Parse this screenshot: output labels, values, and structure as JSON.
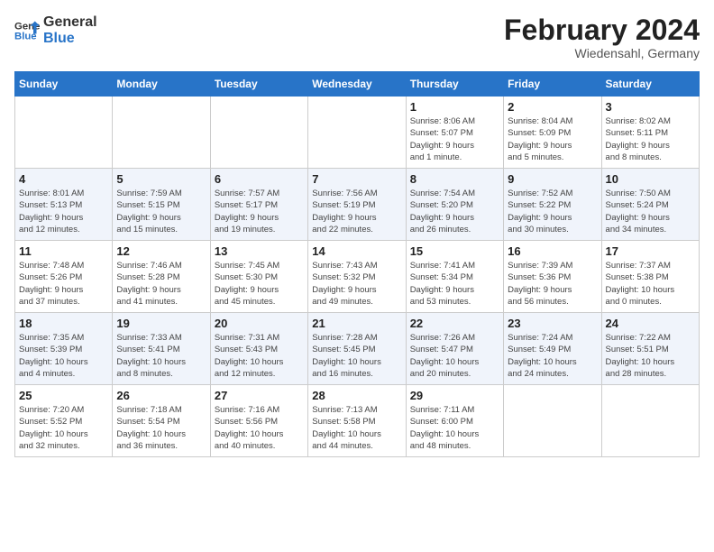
{
  "header": {
    "logo_general": "General",
    "logo_blue": "Blue",
    "title": "February 2024",
    "location": "Wiedensahl, Germany"
  },
  "calendar": {
    "days_of_week": [
      "Sunday",
      "Monday",
      "Tuesday",
      "Wednesday",
      "Thursday",
      "Friday",
      "Saturday"
    ],
    "weeks": [
      [
        {
          "day": "",
          "info": ""
        },
        {
          "day": "",
          "info": ""
        },
        {
          "day": "",
          "info": ""
        },
        {
          "day": "",
          "info": ""
        },
        {
          "day": "1",
          "info": "Sunrise: 8:06 AM\nSunset: 5:07 PM\nDaylight: 9 hours\nand 1 minute."
        },
        {
          "day": "2",
          "info": "Sunrise: 8:04 AM\nSunset: 5:09 PM\nDaylight: 9 hours\nand 5 minutes."
        },
        {
          "day": "3",
          "info": "Sunrise: 8:02 AM\nSunset: 5:11 PM\nDaylight: 9 hours\nand 8 minutes."
        }
      ],
      [
        {
          "day": "4",
          "info": "Sunrise: 8:01 AM\nSunset: 5:13 PM\nDaylight: 9 hours\nand 12 minutes."
        },
        {
          "day": "5",
          "info": "Sunrise: 7:59 AM\nSunset: 5:15 PM\nDaylight: 9 hours\nand 15 minutes."
        },
        {
          "day": "6",
          "info": "Sunrise: 7:57 AM\nSunset: 5:17 PM\nDaylight: 9 hours\nand 19 minutes."
        },
        {
          "day": "7",
          "info": "Sunrise: 7:56 AM\nSunset: 5:19 PM\nDaylight: 9 hours\nand 22 minutes."
        },
        {
          "day": "8",
          "info": "Sunrise: 7:54 AM\nSunset: 5:20 PM\nDaylight: 9 hours\nand 26 minutes."
        },
        {
          "day": "9",
          "info": "Sunrise: 7:52 AM\nSunset: 5:22 PM\nDaylight: 9 hours\nand 30 minutes."
        },
        {
          "day": "10",
          "info": "Sunrise: 7:50 AM\nSunset: 5:24 PM\nDaylight: 9 hours\nand 34 minutes."
        }
      ],
      [
        {
          "day": "11",
          "info": "Sunrise: 7:48 AM\nSunset: 5:26 PM\nDaylight: 9 hours\nand 37 minutes."
        },
        {
          "day": "12",
          "info": "Sunrise: 7:46 AM\nSunset: 5:28 PM\nDaylight: 9 hours\nand 41 minutes."
        },
        {
          "day": "13",
          "info": "Sunrise: 7:45 AM\nSunset: 5:30 PM\nDaylight: 9 hours\nand 45 minutes."
        },
        {
          "day": "14",
          "info": "Sunrise: 7:43 AM\nSunset: 5:32 PM\nDaylight: 9 hours\nand 49 minutes."
        },
        {
          "day": "15",
          "info": "Sunrise: 7:41 AM\nSunset: 5:34 PM\nDaylight: 9 hours\nand 53 minutes."
        },
        {
          "day": "16",
          "info": "Sunrise: 7:39 AM\nSunset: 5:36 PM\nDaylight: 9 hours\nand 56 minutes."
        },
        {
          "day": "17",
          "info": "Sunrise: 7:37 AM\nSunset: 5:38 PM\nDaylight: 10 hours\nand 0 minutes."
        }
      ],
      [
        {
          "day": "18",
          "info": "Sunrise: 7:35 AM\nSunset: 5:39 PM\nDaylight: 10 hours\nand 4 minutes."
        },
        {
          "day": "19",
          "info": "Sunrise: 7:33 AM\nSunset: 5:41 PM\nDaylight: 10 hours\nand 8 minutes."
        },
        {
          "day": "20",
          "info": "Sunrise: 7:31 AM\nSunset: 5:43 PM\nDaylight: 10 hours\nand 12 minutes."
        },
        {
          "day": "21",
          "info": "Sunrise: 7:28 AM\nSunset: 5:45 PM\nDaylight: 10 hours\nand 16 minutes."
        },
        {
          "day": "22",
          "info": "Sunrise: 7:26 AM\nSunset: 5:47 PM\nDaylight: 10 hours\nand 20 minutes."
        },
        {
          "day": "23",
          "info": "Sunrise: 7:24 AM\nSunset: 5:49 PM\nDaylight: 10 hours\nand 24 minutes."
        },
        {
          "day": "24",
          "info": "Sunrise: 7:22 AM\nSunset: 5:51 PM\nDaylight: 10 hours\nand 28 minutes."
        }
      ],
      [
        {
          "day": "25",
          "info": "Sunrise: 7:20 AM\nSunset: 5:52 PM\nDaylight: 10 hours\nand 32 minutes."
        },
        {
          "day": "26",
          "info": "Sunrise: 7:18 AM\nSunset: 5:54 PM\nDaylight: 10 hours\nand 36 minutes."
        },
        {
          "day": "27",
          "info": "Sunrise: 7:16 AM\nSunset: 5:56 PM\nDaylight: 10 hours\nand 40 minutes."
        },
        {
          "day": "28",
          "info": "Sunrise: 7:13 AM\nSunset: 5:58 PM\nDaylight: 10 hours\nand 44 minutes."
        },
        {
          "day": "29",
          "info": "Sunrise: 7:11 AM\nSunset: 6:00 PM\nDaylight: 10 hours\nand 48 minutes."
        },
        {
          "day": "",
          "info": ""
        },
        {
          "day": "",
          "info": ""
        }
      ]
    ]
  }
}
